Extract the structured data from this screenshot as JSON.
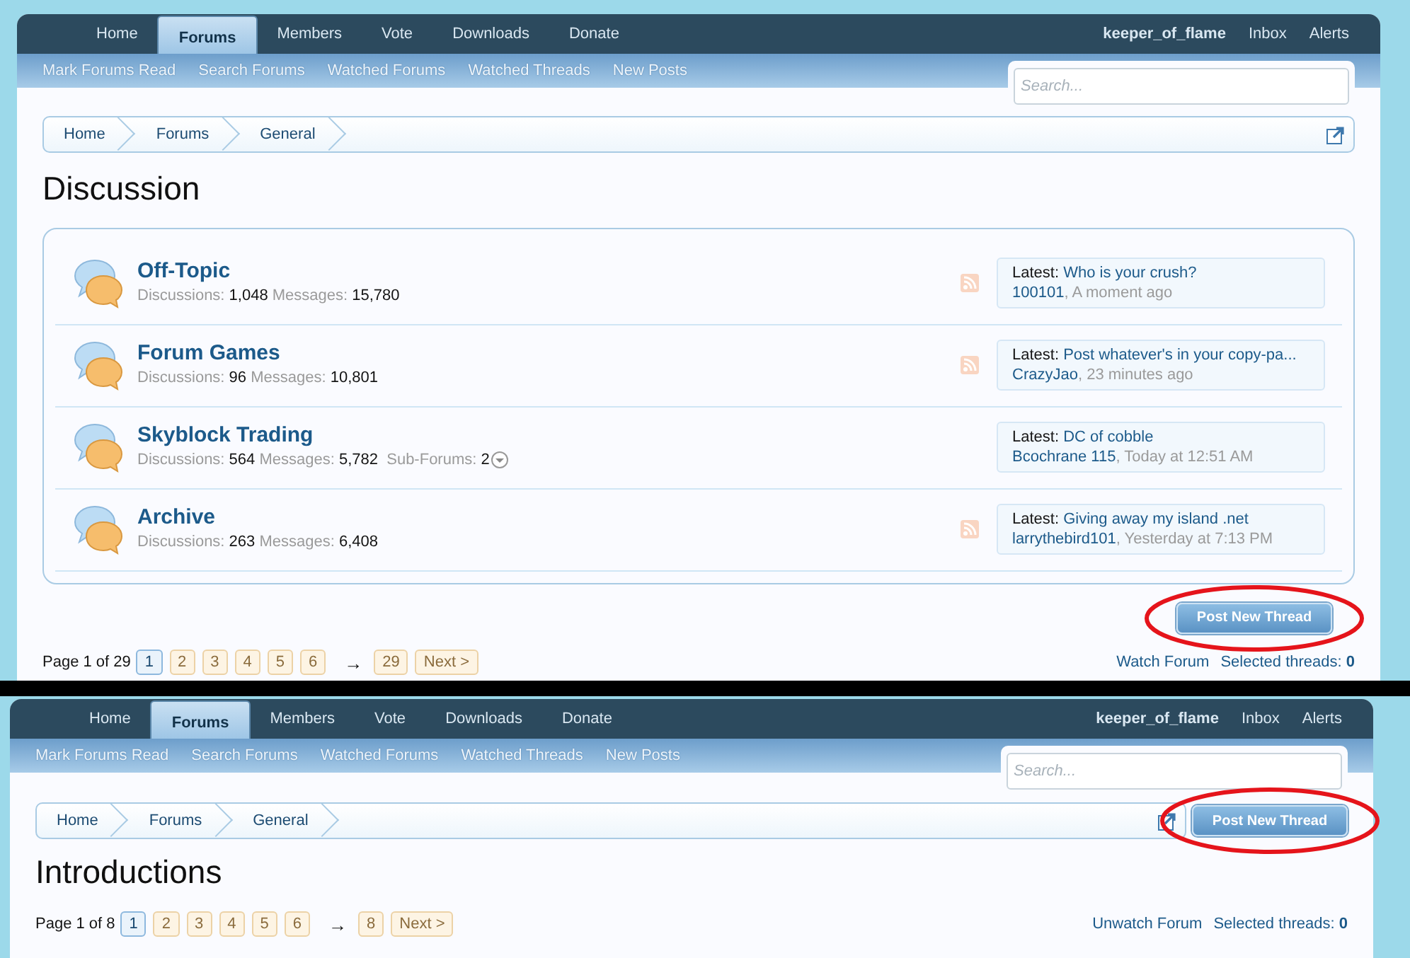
{
  "panels": [
    {
      "nav": {
        "tabs": [
          {
            "label": "Home",
            "selected": false
          },
          {
            "label": "Forums",
            "selected": true
          },
          {
            "label": "Members",
            "selected": false
          },
          {
            "label": "Vote",
            "selected": false
          },
          {
            "label": "Downloads",
            "selected": false
          },
          {
            "label": "Donate",
            "selected": false
          }
        ],
        "user_links": [
          "keeper_of_flame",
          "Inbox",
          "Alerts"
        ]
      },
      "subnav": [
        "Mark Forums Read",
        "Search Forums",
        "Watched Forums",
        "Watched Threads",
        "New Posts"
      ],
      "search": {
        "placeholder": "Search..."
      },
      "breadcrumb": {
        "items": [
          "Home",
          "Forums",
          "General"
        ]
      },
      "title": "Discussion",
      "forums": [
        {
          "name": "Off-Topic",
          "discussions_label": "Discussions:",
          "discussions": "1,048",
          "messages_label": "Messages:",
          "messages": "15,780",
          "rss": true,
          "latest_label": "Latest:",
          "latest_title": "Who is your crush?",
          "latest_user": "100101",
          "latest_time": ", A moment ago"
        },
        {
          "name": "Forum Games",
          "discussions_label": "Discussions:",
          "discussions": "96",
          "messages_label": "Messages:",
          "messages": "10,801",
          "rss": true,
          "latest_label": "Latest:",
          "latest_title": "Post whatever's in your copy-pa...",
          "latest_user": "CrazyJao",
          "latest_time": ", 23 minutes ago"
        },
        {
          "name": "Skyblock Trading",
          "discussions_label": "Discussions:",
          "discussions": "564",
          "messages_label": "Messages:",
          "messages": "5,782",
          "subforums_label": "Sub-Forums:",
          "subforums": "2",
          "rss": false,
          "latest_label": "Latest:",
          "latest_title": "DC of cobble",
          "latest_user": "Bcochrane 115",
          "latest_time": ", Today at 12:51 AM"
        },
        {
          "name": "Archive",
          "discussions_label": "Discussions:",
          "discussions": "263",
          "messages_label": "Messages:",
          "messages": "6,408",
          "rss": true,
          "latest_label": "Latest:",
          "latest_title": "Giving away my island .net",
          "latest_user": "larrythebird101",
          "latest_time": ", Yesterday at 7:13 PM"
        }
      ],
      "post_button": {
        "label": "Post New Thread",
        "circled": true
      },
      "pagination": {
        "summary": "Page 1 of 29",
        "pages": [
          {
            "label": "1",
            "selected": true
          },
          {
            "label": "2",
            "selected": false
          },
          {
            "label": "3",
            "selected": false
          },
          {
            "label": "4",
            "selected": false
          },
          {
            "label": "5",
            "selected": false
          },
          {
            "label": "6",
            "selected": false
          }
        ],
        "arrow": "→",
        "last_page": {
          "label": "29",
          "selected": false
        },
        "next": "Next >"
      },
      "footer_link": "Watch Forum",
      "selected_threads_label": "Selected threads:",
      "selected_threads": "0"
    },
    {
      "nav": {
        "tabs": [
          {
            "label": "Home",
            "selected": false
          },
          {
            "label": "Forums",
            "selected": true
          },
          {
            "label": "Members",
            "selected": false
          },
          {
            "label": "Vote",
            "selected": false
          },
          {
            "label": "Downloads",
            "selected": false
          },
          {
            "label": "Donate",
            "selected": false
          }
        ],
        "user_links": [
          "keeper_of_flame",
          "Inbox",
          "Alerts"
        ]
      },
      "subnav": [
        "Mark Forums Read",
        "Search Forums",
        "Watched Forums",
        "Watched Threads",
        "New Posts"
      ],
      "search": {
        "placeholder": "Search..."
      },
      "breadcrumb": {
        "items": [
          "Home",
          "Forums",
          "General"
        ],
        "post_button": {
          "label": "Post New Thread",
          "circled": true
        }
      },
      "title": "Introductions",
      "pagination": {
        "summary": "Page 1 of 8",
        "pages": [
          {
            "label": "1",
            "selected": true
          },
          {
            "label": "2",
            "selected": false
          },
          {
            "label": "3",
            "selected": false
          },
          {
            "label": "4",
            "selected": false
          },
          {
            "label": "5",
            "selected": false
          },
          {
            "label": "6",
            "selected": false
          }
        ],
        "arrow": "→",
        "last_page": {
          "label": "8",
          "selected": false
        },
        "next": "Next >"
      },
      "footer_link": "Unwatch Forum",
      "selected_threads_label": "Selected threads:",
      "selected_threads": "0"
    }
  ]
}
